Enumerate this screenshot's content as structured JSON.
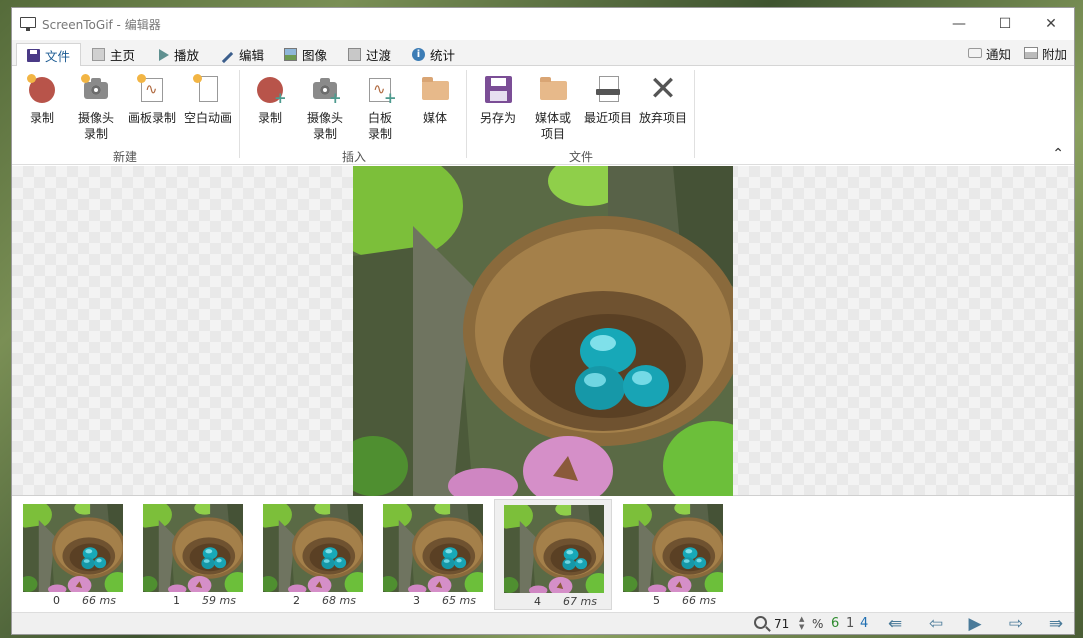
{
  "window": {
    "title": "ScreenToGif - 编辑器"
  },
  "title_controls": {
    "minimize": "—",
    "maximize": "☐",
    "close": "✕"
  },
  "tabs": [
    {
      "label": "文件",
      "icon": "save-icon"
    },
    {
      "label": "主页",
      "icon": "home-icon"
    },
    {
      "label": "播放",
      "icon": "play-icon"
    },
    {
      "label": "编辑",
      "icon": "pen-icon"
    },
    {
      "label": "图像",
      "icon": "image-icon"
    },
    {
      "label": "过渡",
      "icon": "transition-icon"
    },
    {
      "label": "统计",
      "icon": "info-icon"
    }
  ],
  "tabs_right": {
    "notify": "通知",
    "extras": "附加"
  },
  "ribbon": {
    "new_group": {
      "label": "新建",
      "items": [
        {
          "label": "录制"
        },
        {
          "label": "摄像头\n录制"
        },
        {
          "label": "画板录制"
        },
        {
          "label": "空白动画"
        }
      ]
    },
    "insert_group": {
      "label": "插入",
      "items": [
        {
          "label": "录制"
        },
        {
          "label": "摄像头\n录制"
        },
        {
          "label": "白板\n录制"
        },
        {
          "label": "媒体"
        }
      ]
    },
    "file_group": {
      "label": "文件",
      "items": [
        {
          "label": "另存为"
        },
        {
          "label": "媒体或\n项目"
        },
        {
          "label": "最近项目"
        },
        {
          "label": "放弃项目"
        }
      ]
    },
    "collapse": "⌃"
  },
  "frames": [
    {
      "index": "0",
      "duration": "66 ms"
    },
    {
      "index": "1",
      "duration": "59 ms"
    },
    {
      "index": "2",
      "duration": "68 ms"
    },
    {
      "index": "3",
      "duration": "65 ms"
    },
    {
      "index": "4",
      "duration": "67 ms"
    },
    {
      "index": "5",
      "duration": "66 ms"
    }
  ],
  "status": {
    "zoom": "71",
    "zoom_unit": "%",
    "frame_count": "6",
    "selected_count": "1",
    "current_frame": "4",
    "colors": {
      "count": "#2e8b2e",
      "selected": "#555555",
      "current": "#1f6fb2"
    }
  },
  "nav": {
    "first": "⇚",
    "prev": "⇦",
    "play": "▶",
    "next": "⇨",
    "last": "⇛"
  }
}
